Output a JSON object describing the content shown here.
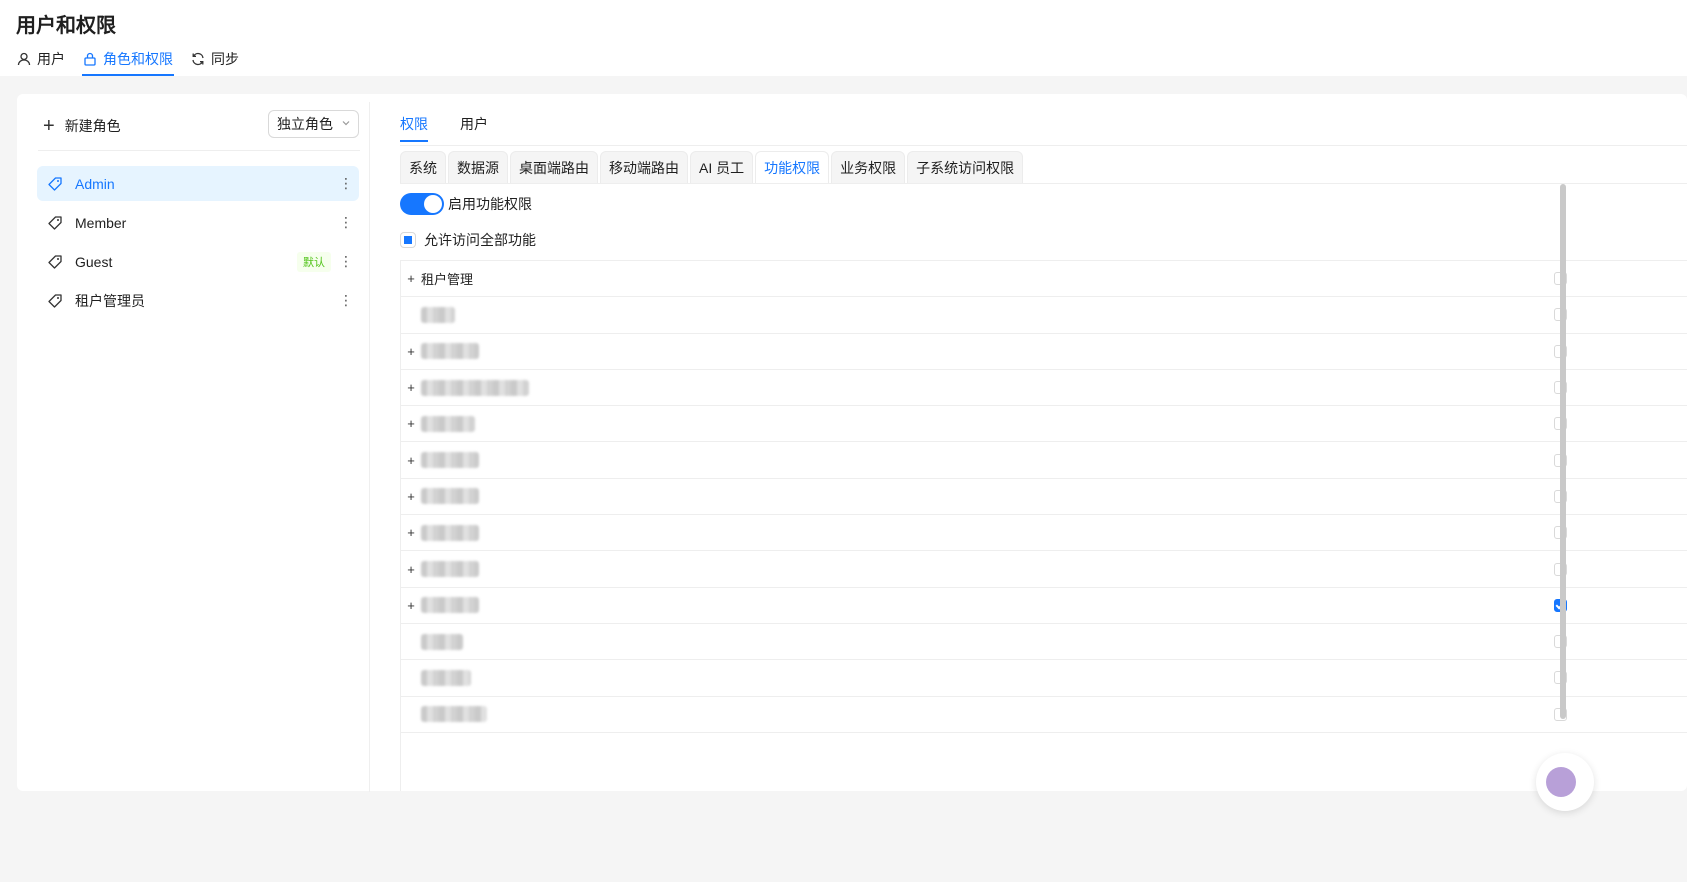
{
  "page": {
    "title": "用户和权限"
  },
  "top_tabs": [
    {
      "label": "用户",
      "icon": "user-icon",
      "active": false
    },
    {
      "label": "角色和权限",
      "icon": "lock-icon",
      "active": true
    },
    {
      "label": "同步",
      "icon": "sync-icon",
      "active": false
    }
  ],
  "left_panel": {
    "new_role_label": "新建角色",
    "mode_select_value": "独立角色",
    "roles": [
      {
        "name": "Admin",
        "active": true,
        "badge": ""
      },
      {
        "name": "Member",
        "active": false,
        "badge": ""
      },
      {
        "name": "Guest",
        "active": false,
        "badge": "默认"
      },
      {
        "name": "租户管理员",
        "active": false,
        "badge": ""
      }
    ]
  },
  "right_panel": {
    "sub_tabs": [
      {
        "label": "权限",
        "active": true
      },
      {
        "label": "用户",
        "active": false
      }
    ],
    "card_tabs": [
      {
        "label": "系统",
        "active": false
      },
      {
        "label": "数据源",
        "active": false
      },
      {
        "label": "桌面端路由",
        "active": false
      },
      {
        "label": "移动端路由",
        "active": false
      },
      {
        "label": "AI 员工",
        "active": false
      },
      {
        "label": "功能权限",
        "active": true
      },
      {
        "label": "业务权限",
        "active": false
      },
      {
        "label": "子系统访问权限",
        "active": false
      }
    ],
    "toggle_label": "启用功能权限",
    "toggle_on": true,
    "allow_all_label": "允许访问全部功能",
    "permissions": [
      {
        "label": "租户管理",
        "expandable": true,
        "checked": false
      },
      {
        "label": "",
        "expandable": false,
        "checked": false
      },
      {
        "label": "",
        "expandable": true,
        "checked": false
      },
      {
        "label": "",
        "expandable": true,
        "checked": false
      },
      {
        "label": "",
        "expandable": true,
        "checked": false
      },
      {
        "label": "",
        "expandable": true,
        "checked": false
      },
      {
        "label": "",
        "expandable": true,
        "checked": false
      },
      {
        "label": "",
        "expandable": true,
        "checked": false
      },
      {
        "label": "",
        "expandable": true,
        "checked": false
      },
      {
        "label": "",
        "expandable": true,
        "checked": true
      },
      {
        "label": "",
        "expandable": false,
        "checked": false
      },
      {
        "label": "",
        "expandable": false,
        "checked": false
      },
      {
        "label": "",
        "expandable": false,
        "checked": false
      }
    ]
  },
  "colors": {
    "accent": "#1677ff",
    "badge_green": "#52c41a"
  }
}
